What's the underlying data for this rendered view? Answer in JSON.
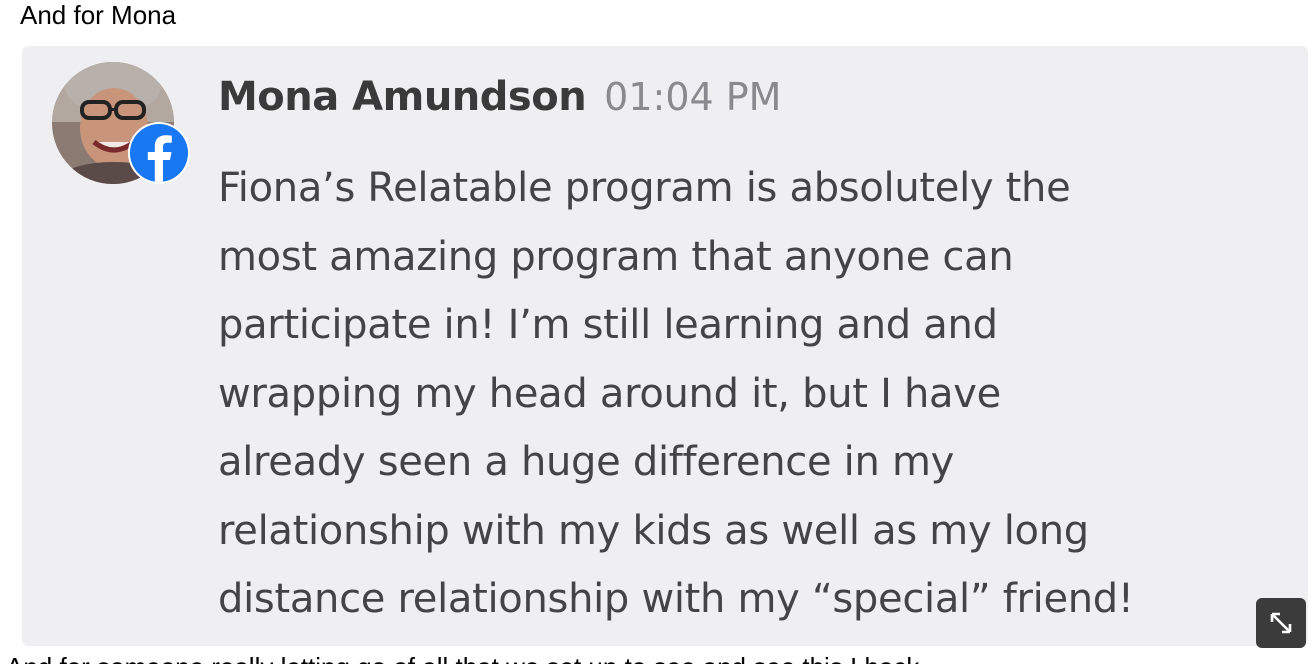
{
  "intro": "And for Mona",
  "post": {
    "author": "Mona Amundson",
    "time": "01:04 PM",
    "source_icon": "facebook-icon",
    "avatar_icon": "profile-photo",
    "message_lines": [
      "Fiona’s Relatable program is absolutely the",
      "most amazing program that anyone can",
      "participate in! I’m still learning and and",
      "wrapping my head around it, but I have",
      "already seen a huge difference in my",
      "relationship with my kids as well as my long",
      "distance relationship with my “special” friend!"
    ],
    "expand_icon": "expand-icon"
  },
  "next_line": "And for someone really letting go of all that we set up to see and see this I back",
  "colors": {
    "card_bg": "#efeff1",
    "facebook": "#1877f2",
    "author": "#3a3a3a",
    "time": "#8a8a8e",
    "text": "#444446",
    "expand_bg": "#3b3b3b"
  }
}
